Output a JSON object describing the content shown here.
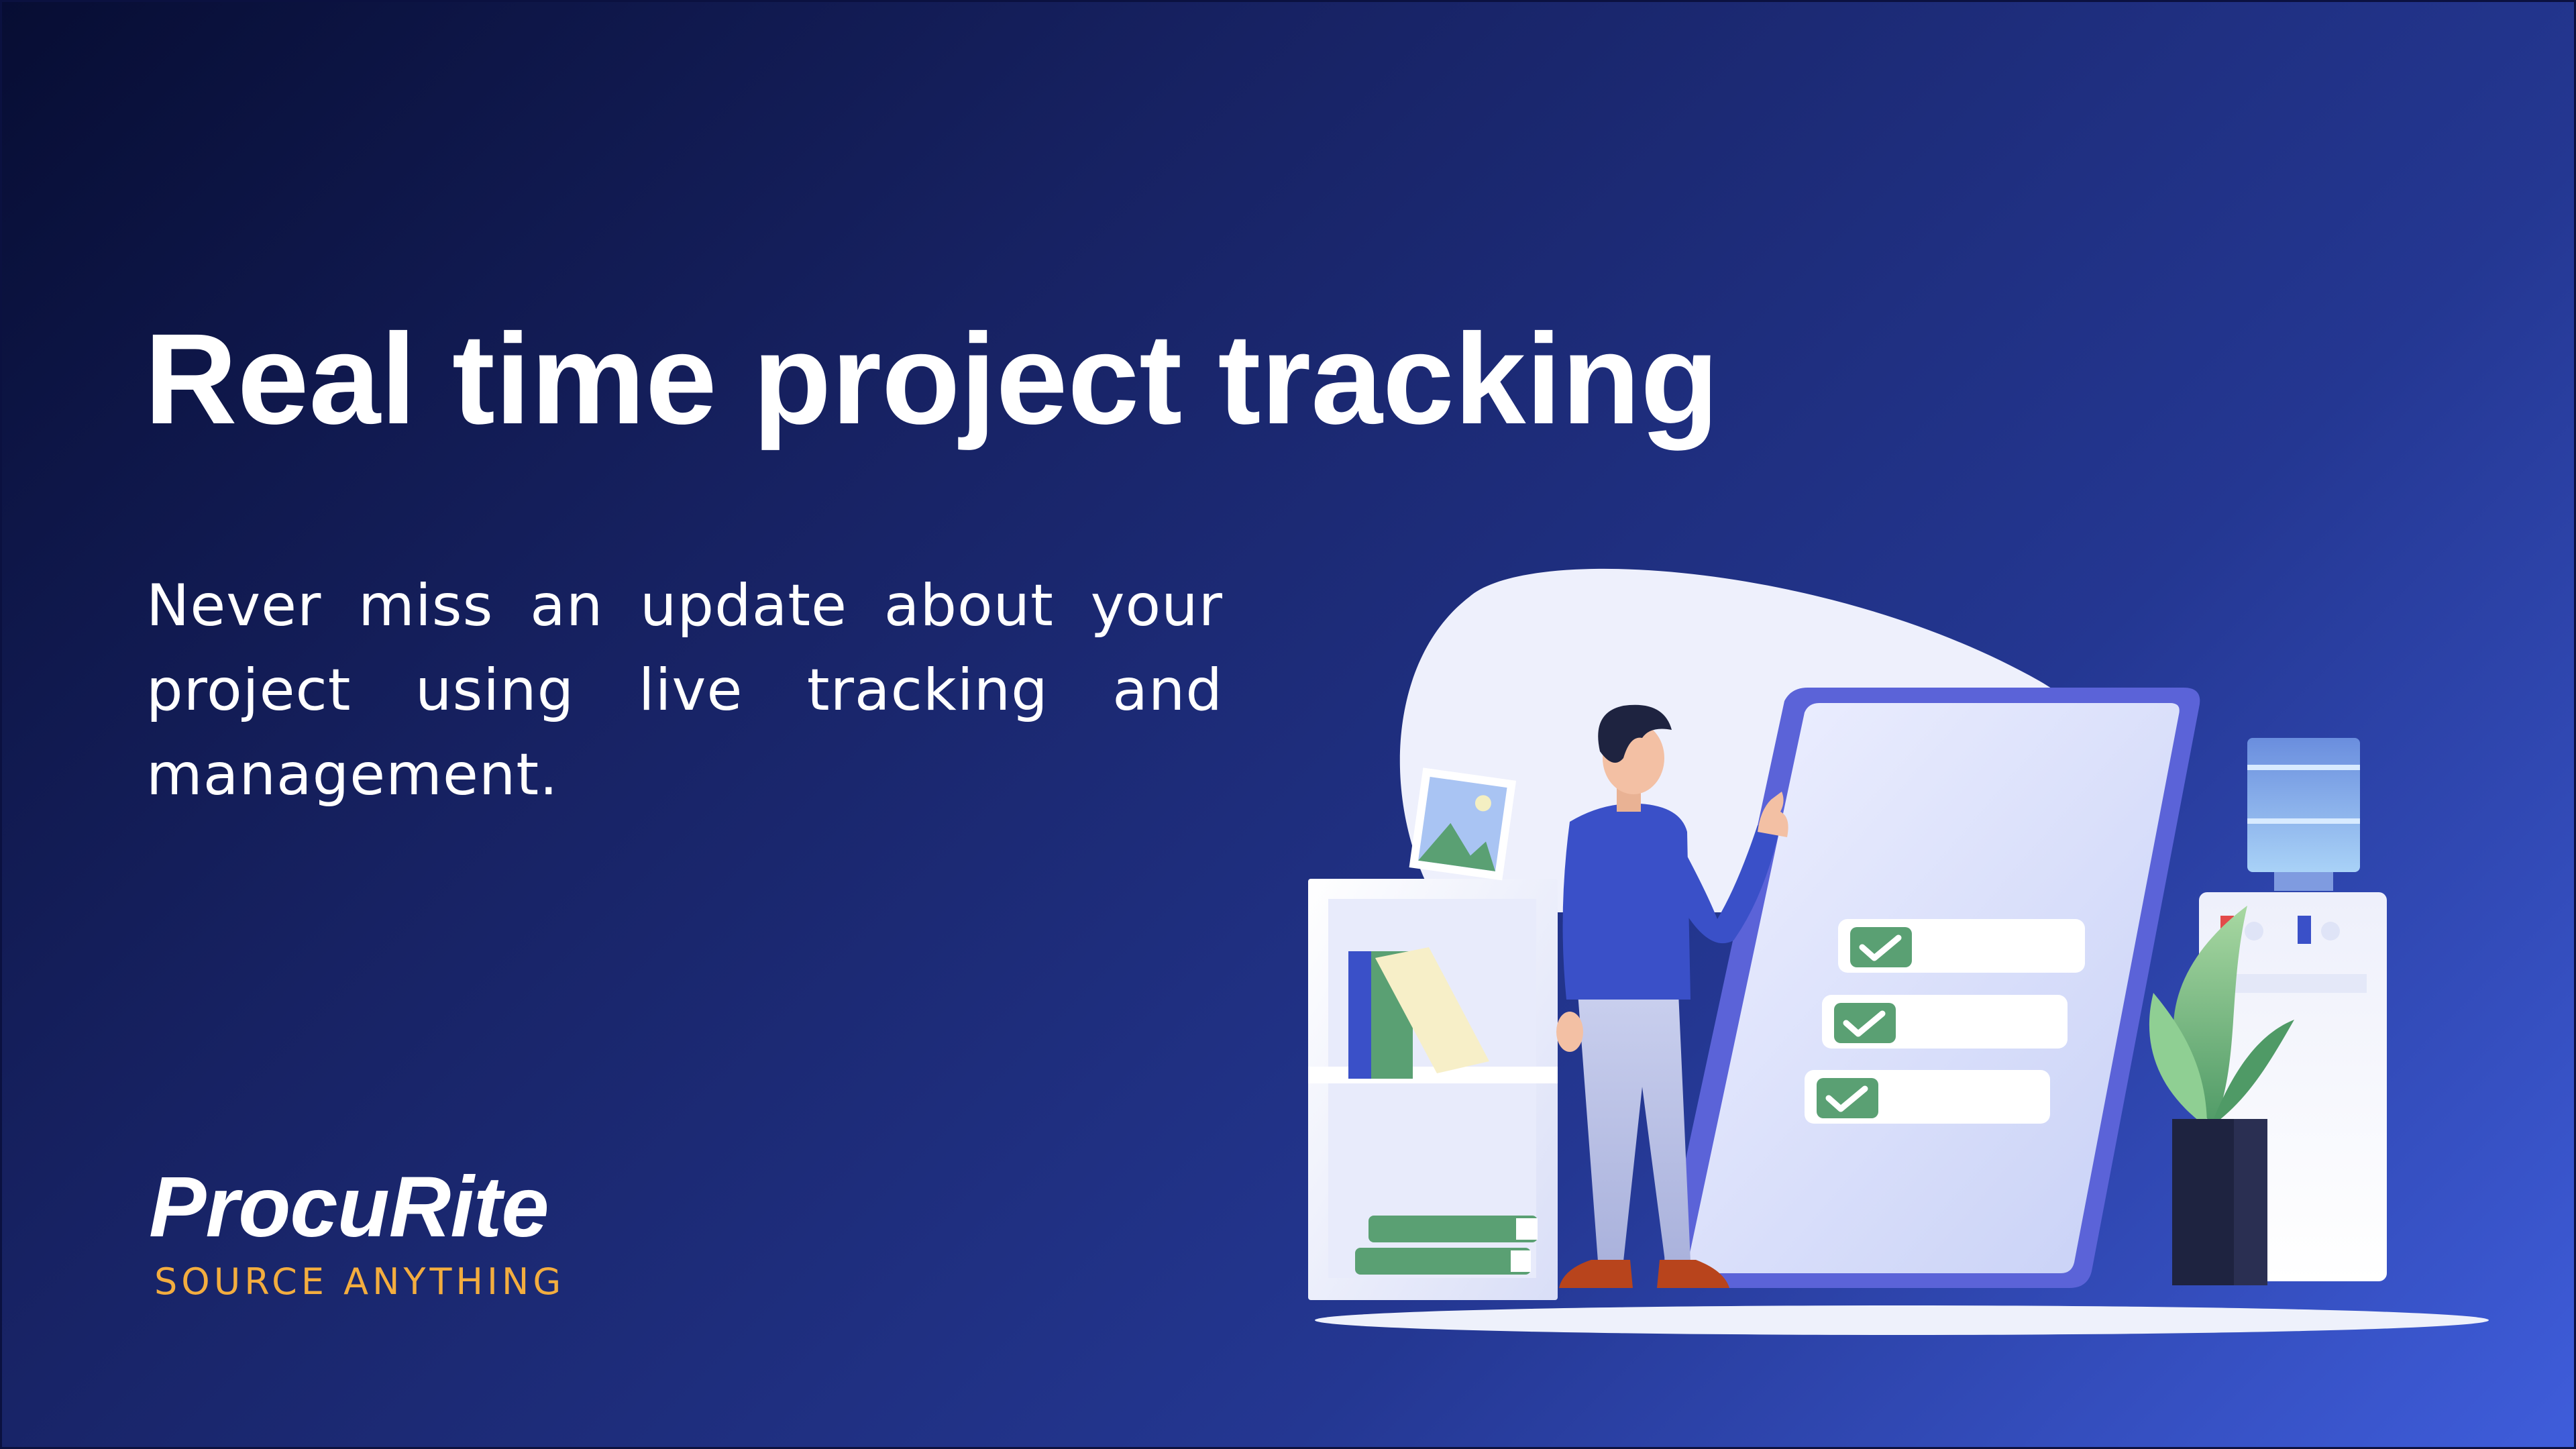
{
  "slide": {
    "title": "Real time project tracking",
    "description": "Never miss an update about your project using live tracking and management."
  },
  "brand": {
    "name": "ProcuRite",
    "tagline": "SOURCE ANYTHING"
  },
  "illustration": {
    "checklist_items": 3,
    "colors": {
      "background_start": "#070d33",
      "background_end": "#3f5ddb",
      "accent_tagline": "#f3ad3f",
      "checkbox": "#5aa073",
      "board_frame": "#5b63d8"
    }
  }
}
